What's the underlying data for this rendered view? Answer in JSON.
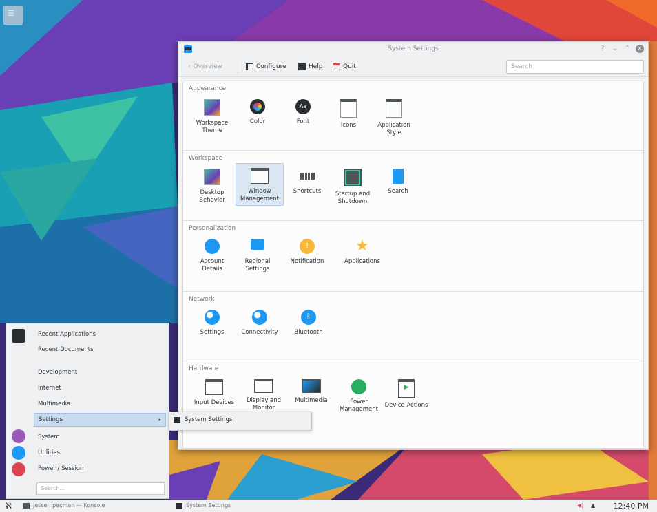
{
  "window": {
    "title": "System Settings",
    "toolbar": {
      "overview": "Overview",
      "configure": "Configure",
      "help": "Help",
      "quit": "Quit",
      "search_placeholder": "Search"
    },
    "categories": [
      {
        "title": "Appearance",
        "modules": [
          {
            "label": "Workspace Theme",
            "icon": "workspace-theme-icon"
          },
          {
            "label": "Color",
            "icon": "color-icon"
          },
          {
            "label": "Font",
            "icon": "font-icon"
          },
          {
            "label": "Icons",
            "icon": "icons-icon"
          },
          {
            "label": "Application Style",
            "icon": "application-style-icon"
          }
        ]
      },
      {
        "title": "Workspace",
        "modules": [
          {
            "label": "Desktop Behavior",
            "icon": "desktop-behavior-icon"
          },
          {
            "label": "Window Management",
            "icon": "window-management-icon"
          },
          {
            "label": "Shortcuts",
            "icon": "keyboard-icon"
          },
          {
            "label": "Startup and Shutdown",
            "icon": "startup-shutdown-icon"
          },
          {
            "label": "Search",
            "icon": "search-doc-icon"
          }
        ]
      },
      {
        "title": "Personalization",
        "modules": [
          {
            "label": "Account Details",
            "icon": "account-icon"
          },
          {
            "label": "Regional Settings",
            "icon": "regional-icon"
          },
          {
            "label": "Notification",
            "icon": "notification-icon"
          },
          {
            "label": "Applications",
            "icon": "star-icon"
          }
        ]
      },
      {
        "title": "Network",
        "modules": [
          {
            "label": "Settings",
            "icon": "network-settings-icon"
          },
          {
            "label": "Connectivity",
            "icon": "connectivity-icon"
          },
          {
            "label": "Bluetooth",
            "icon": "bluetooth-icon"
          }
        ]
      },
      {
        "title": "Hardware",
        "modules": [
          {
            "label": "Input Devices",
            "icon": "input-devices-icon"
          },
          {
            "label": "Display and Monitor",
            "icon": "display-icon"
          },
          {
            "label": "Multimedia",
            "icon": "multimedia-icon"
          },
          {
            "label": "Power Management",
            "icon": "power-management-icon"
          },
          {
            "label": "Device Actions",
            "icon": "device-actions-icon"
          }
        ]
      }
    ]
  },
  "launcher": {
    "items": [
      "Recent Applications",
      "Recent Documents",
      "Development",
      "Internet",
      "Multimedia",
      "Settings",
      "System",
      "Utilities",
      "Power / Session"
    ],
    "search_placeholder": "Search...",
    "submenu_item": "System Settings"
  },
  "taskbar": {
    "task1": "jesse : pacman — Konsole",
    "task2": "System Settings",
    "clock": "12:40 PM"
  },
  "colors": {
    "accent": "#1d99f3",
    "highlight": "#c9dbef"
  }
}
